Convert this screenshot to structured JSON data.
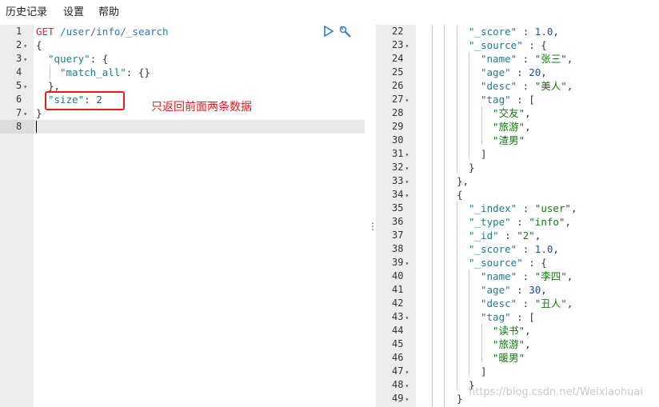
{
  "menu": {
    "history": "历史记录",
    "settings": "设置",
    "help": "帮助"
  },
  "request": {
    "lines": [
      {
        "num": "1",
        "fold": false
      },
      {
        "num": "2",
        "fold": true
      },
      {
        "num": "3",
        "fold": true
      },
      {
        "num": "4",
        "fold": false
      },
      {
        "num": "5",
        "fold": true
      },
      {
        "num": "6",
        "fold": false
      },
      {
        "num": "7",
        "fold": true
      },
      {
        "num": "8",
        "fold": false
      }
    ],
    "method": "GET",
    "url": "/user/info/_search",
    "open_brace": "{",
    "query_key": "\"query\"",
    "match_all_key": "\"match_all\"",
    "match_all_value": "{}",
    "close_query": "},",
    "size_key": "\"size\"",
    "size_value": "2",
    "close_brace": "}"
  },
  "annotation": "只返回前面两条数据",
  "icons": {
    "run": "play-icon",
    "settings": "wrench-icon"
  },
  "response": {
    "line_numbers": [
      "22",
      "23",
      "24",
      "25",
      "26",
      "27",
      "28",
      "29",
      "30",
      "31",
      "32",
      "33",
      "34",
      "35",
      "36",
      "37",
      "38",
      "39",
      "40",
      "41",
      "42",
      "43",
      "44",
      "45",
      "46",
      "47",
      "48",
      "49"
    ],
    "folds": [
      false,
      true,
      false,
      false,
      false,
      true,
      false,
      false,
      false,
      true,
      true,
      true,
      true,
      false,
      false,
      false,
      false,
      true,
      false,
      false,
      false,
      true,
      false,
      false,
      false,
      true,
      true,
      true
    ],
    "hit1": {
      "score_key": "\"_score\"",
      "score": "1.0",
      "source_key": "\"_source\"",
      "name_key": "\"name\"",
      "name": "\"张三\"",
      "age_key": "\"age\"",
      "age": "20",
      "desc_key": "\"desc\"",
      "desc": "\"美人\"",
      "tag_key": "\"tag\"",
      "tags": [
        "\"交友\"",
        "\"旅游\"",
        "\"渣男\""
      ]
    },
    "hit2": {
      "index_key": "\"_index\"",
      "index": "\"user\"",
      "type_key": "\"_type\"",
      "type": "\"info\"",
      "id_key": "\"_id\"",
      "id": "\"2\"",
      "score_key": "\"_score\"",
      "score": "1.0",
      "source_key": "\"_source\"",
      "name_key": "\"name\"",
      "name": "\"李四\"",
      "age_key": "\"age\"",
      "age": "30",
      "desc_key": "\"desc\"",
      "desc": "\"丑人\"",
      "tag_key": "\"tag\"",
      "tags": [
        "\"读书\"",
        "\"旅游\"",
        "\"暖男\""
      ]
    }
  },
  "watermark": "https://blog.csdn.net/Weixiaohuai"
}
